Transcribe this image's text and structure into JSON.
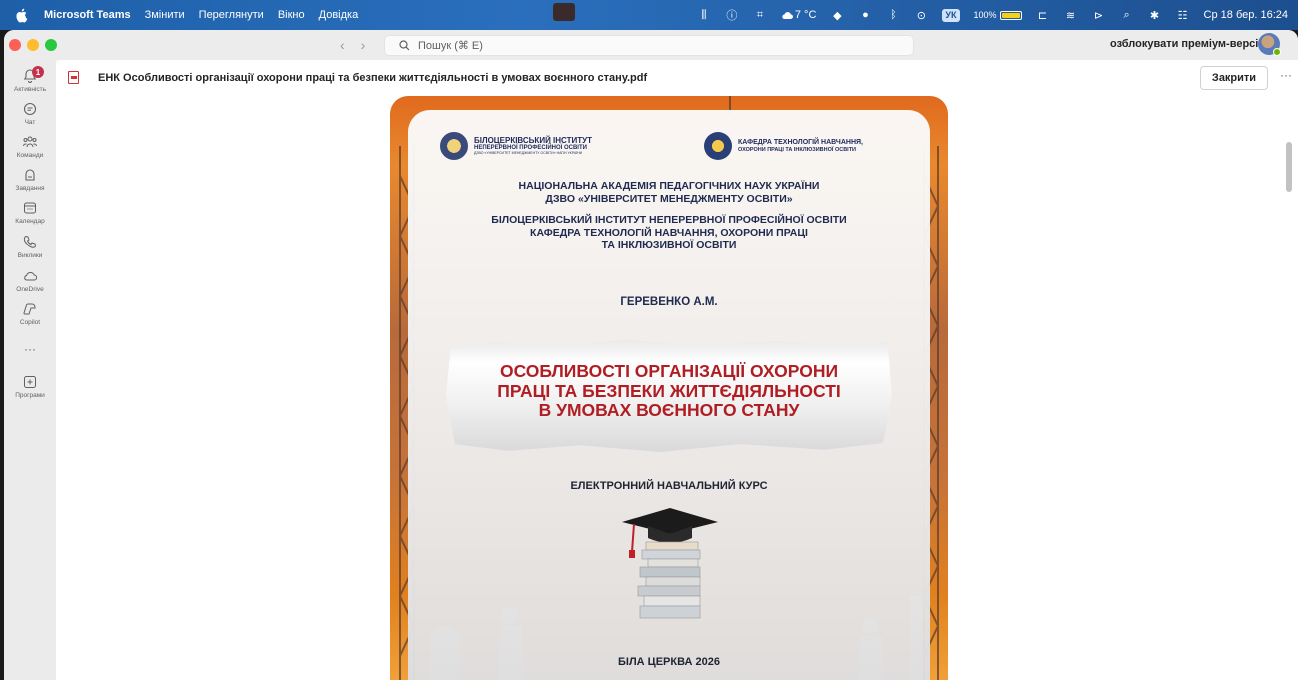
{
  "menubar": {
    "app_name": "Microsoft Teams",
    "items": [
      "Змінити",
      "Переглянути",
      "Вікно",
      "Довідка"
    ],
    "weather": "7 °C",
    "keyboard": "УК",
    "battery": "100%",
    "datetime": "Ср 18 бер.  16:24",
    "accent_color": "#1e5fa8"
  },
  "titlebar": {
    "search_placeholder": "Пошук (⌘ E)",
    "premium_label": "озблокувати преміум-версію"
  },
  "rail": {
    "items": [
      {
        "label": "Активність",
        "icon": "bell-icon",
        "badge": "1"
      },
      {
        "label": "Чат",
        "icon": "chat-icon"
      },
      {
        "label": "Команди",
        "icon": "teams-icon"
      },
      {
        "label": "Завдання",
        "icon": "tasks-icon"
      },
      {
        "label": "Календар",
        "icon": "calendar-icon"
      },
      {
        "label": "Виклики",
        "icon": "phone-icon"
      },
      {
        "label": "OneDrive",
        "icon": "cloud-icon"
      },
      {
        "label": "Copilot",
        "icon": "copilot-icon"
      },
      {
        "label": "Програми",
        "icon": "apps-icon"
      }
    ],
    "more_label": "···"
  },
  "file": {
    "name": "ЕНК Особливості організації охорони праці та безпеки життєдіяльності в умовах воєнного стану.pdf",
    "close_label": "Закрити",
    "more_label": "···"
  },
  "cover": {
    "logo_left_line1": "БІЛОЦЕРКІВСЬКИЙ ІНСТИТУТ",
    "logo_left_line2": "НЕПЕРЕРВНОЇ ПРОФЕСІЙНОЇ ОСВІТИ",
    "logo_left_line3": "ДЗВО «УНІВЕРСИТЕТ МЕНЕДЖМЕНТУ ОСВІТИ» НАПН УКРАЇНИ",
    "logo_right_line1": "КАФЕДРА ТЕХНОЛОГІЙ НАВЧАННЯ,",
    "logo_right_line2": "ОХОРОНИ ПРАЦІ ТА ІНКЛЮЗИВНОЇ ОСВІТИ",
    "org_line1": "НАЦІОНАЛЬНА АКАДЕМІЯ ПЕДАГОГІЧНИХ НАУК УКРАЇНИ",
    "org_line2": "ДЗВО «УНІВЕРСИТЕТ МЕНЕДЖМЕНТУ ОСВІТИ»",
    "inst_line1": "БІЛОЦЕРКІВСЬКИЙ ІНСТИТУТ НЕПЕРЕРВНОЇ ПРОФЕСІЙНОЇ ОСВІТИ",
    "inst_line2": "КАФЕДРА ТЕХНОЛОГІЙ НАВЧАННЯ, ОХОРОНИ ПРАЦІ",
    "inst_line3": "ТА ІНКЛЮЗИВНОЇ ОСВІТИ",
    "author": "ГЕРЕВЕНКО А.М.",
    "title_line1": "ОСОБЛИВОСТІ ОРГАНІЗАЦІЇ ОХОРОНИ",
    "title_line2": "ПРАЦІ ТА БЕЗПЕКИ ЖИТТЄДІЯЛЬНОСТІ",
    "title_line3": "В УМОВАХ ВОЄННОГО СТАНУ",
    "course_type": "ЕЛЕКТРОННИЙ НАВЧАЛЬНИЙ КУРС",
    "city_year": "БІЛА ЦЕРКВА 2026",
    "title_color": "#b01e24"
  }
}
